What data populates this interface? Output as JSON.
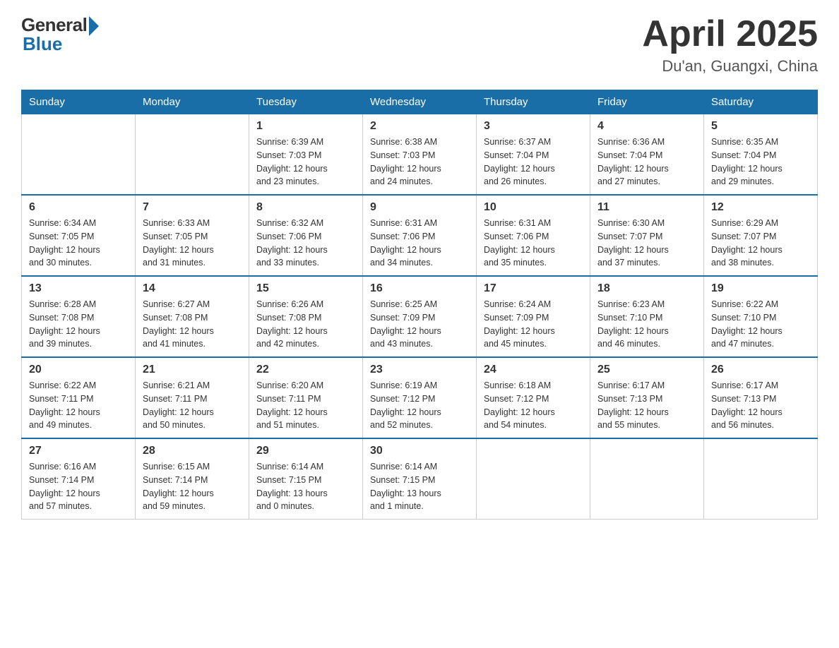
{
  "header": {
    "logo_general": "General",
    "logo_blue": "Blue",
    "title": "April 2025",
    "location": "Du'an, Guangxi, China"
  },
  "weekdays": [
    "Sunday",
    "Monday",
    "Tuesday",
    "Wednesday",
    "Thursday",
    "Friday",
    "Saturday"
  ],
  "weeks": [
    {
      "days": [
        {
          "number": "",
          "info": ""
        },
        {
          "number": "",
          "info": ""
        },
        {
          "number": "1",
          "info": "Sunrise: 6:39 AM\nSunset: 7:03 PM\nDaylight: 12 hours\nand 23 minutes."
        },
        {
          "number": "2",
          "info": "Sunrise: 6:38 AM\nSunset: 7:03 PM\nDaylight: 12 hours\nand 24 minutes."
        },
        {
          "number": "3",
          "info": "Sunrise: 6:37 AM\nSunset: 7:04 PM\nDaylight: 12 hours\nand 26 minutes."
        },
        {
          "number": "4",
          "info": "Sunrise: 6:36 AM\nSunset: 7:04 PM\nDaylight: 12 hours\nand 27 minutes."
        },
        {
          "number": "5",
          "info": "Sunrise: 6:35 AM\nSunset: 7:04 PM\nDaylight: 12 hours\nand 29 minutes."
        }
      ]
    },
    {
      "days": [
        {
          "number": "6",
          "info": "Sunrise: 6:34 AM\nSunset: 7:05 PM\nDaylight: 12 hours\nand 30 minutes."
        },
        {
          "number": "7",
          "info": "Sunrise: 6:33 AM\nSunset: 7:05 PM\nDaylight: 12 hours\nand 31 minutes."
        },
        {
          "number": "8",
          "info": "Sunrise: 6:32 AM\nSunset: 7:06 PM\nDaylight: 12 hours\nand 33 minutes."
        },
        {
          "number": "9",
          "info": "Sunrise: 6:31 AM\nSunset: 7:06 PM\nDaylight: 12 hours\nand 34 minutes."
        },
        {
          "number": "10",
          "info": "Sunrise: 6:31 AM\nSunset: 7:06 PM\nDaylight: 12 hours\nand 35 minutes."
        },
        {
          "number": "11",
          "info": "Sunrise: 6:30 AM\nSunset: 7:07 PM\nDaylight: 12 hours\nand 37 minutes."
        },
        {
          "number": "12",
          "info": "Sunrise: 6:29 AM\nSunset: 7:07 PM\nDaylight: 12 hours\nand 38 minutes."
        }
      ]
    },
    {
      "days": [
        {
          "number": "13",
          "info": "Sunrise: 6:28 AM\nSunset: 7:08 PM\nDaylight: 12 hours\nand 39 minutes."
        },
        {
          "number": "14",
          "info": "Sunrise: 6:27 AM\nSunset: 7:08 PM\nDaylight: 12 hours\nand 41 minutes."
        },
        {
          "number": "15",
          "info": "Sunrise: 6:26 AM\nSunset: 7:08 PM\nDaylight: 12 hours\nand 42 minutes."
        },
        {
          "number": "16",
          "info": "Sunrise: 6:25 AM\nSunset: 7:09 PM\nDaylight: 12 hours\nand 43 minutes."
        },
        {
          "number": "17",
          "info": "Sunrise: 6:24 AM\nSunset: 7:09 PM\nDaylight: 12 hours\nand 45 minutes."
        },
        {
          "number": "18",
          "info": "Sunrise: 6:23 AM\nSunset: 7:10 PM\nDaylight: 12 hours\nand 46 minutes."
        },
        {
          "number": "19",
          "info": "Sunrise: 6:22 AM\nSunset: 7:10 PM\nDaylight: 12 hours\nand 47 minutes."
        }
      ]
    },
    {
      "days": [
        {
          "number": "20",
          "info": "Sunrise: 6:22 AM\nSunset: 7:11 PM\nDaylight: 12 hours\nand 49 minutes."
        },
        {
          "number": "21",
          "info": "Sunrise: 6:21 AM\nSunset: 7:11 PM\nDaylight: 12 hours\nand 50 minutes."
        },
        {
          "number": "22",
          "info": "Sunrise: 6:20 AM\nSunset: 7:11 PM\nDaylight: 12 hours\nand 51 minutes."
        },
        {
          "number": "23",
          "info": "Sunrise: 6:19 AM\nSunset: 7:12 PM\nDaylight: 12 hours\nand 52 minutes."
        },
        {
          "number": "24",
          "info": "Sunrise: 6:18 AM\nSunset: 7:12 PM\nDaylight: 12 hours\nand 54 minutes."
        },
        {
          "number": "25",
          "info": "Sunrise: 6:17 AM\nSunset: 7:13 PM\nDaylight: 12 hours\nand 55 minutes."
        },
        {
          "number": "26",
          "info": "Sunrise: 6:17 AM\nSunset: 7:13 PM\nDaylight: 12 hours\nand 56 minutes."
        }
      ]
    },
    {
      "days": [
        {
          "number": "27",
          "info": "Sunrise: 6:16 AM\nSunset: 7:14 PM\nDaylight: 12 hours\nand 57 minutes."
        },
        {
          "number": "28",
          "info": "Sunrise: 6:15 AM\nSunset: 7:14 PM\nDaylight: 12 hours\nand 59 minutes."
        },
        {
          "number": "29",
          "info": "Sunrise: 6:14 AM\nSunset: 7:15 PM\nDaylight: 13 hours\nand 0 minutes."
        },
        {
          "number": "30",
          "info": "Sunrise: 6:14 AM\nSunset: 7:15 PM\nDaylight: 13 hours\nand 1 minute."
        },
        {
          "number": "",
          "info": ""
        },
        {
          "number": "",
          "info": ""
        },
        {
          "number": "",
          "info": ""
        }
      ]
    }
  ]
}
